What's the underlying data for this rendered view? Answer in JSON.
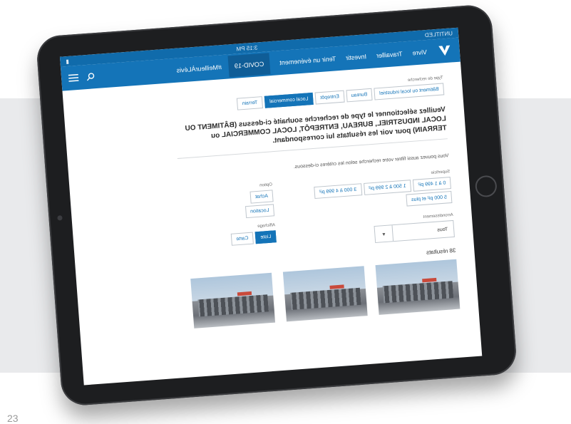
{
  "device": {
    "status_time": "3:15 PM",
    "status_carrier": "UNTITLED"
  },
  "nav": {
    "items": [
      "Vivre",
      "Travailler",
      "Investir",
      "Tenir un événement"
    ],
    "active_item": "COVID-19",
    "extra": "#MeilleurÀLévis"
  },
  "search": {
    "type_label": "Type de recherche",
    "types": [
      "Bâtiment ou local industriel",
      "Bureau",
      "Entrepôt",
      "Local commercial",
      "Terrain"
    ],
    "active_type": "Local commercial",
    "notice": "Veuillez sélectionner le type de recherche souhaité ci-dessus (BÂTIMENT OU LOCAL INDUSTRIEL, BUREAU, ENTREPÔT, LOCAL COMMERCIAL ou TERRAIN) pour voir les résultats lui correspondant.",
    "hint": "Vous pouvez aussi filtrer votre recherche selon les critères ci-dessous."
  },
  "filters": {
    "superficie_label": "Superficie",
    "superficie_options": [
      "0 à 1 499 pi²",
      "1 500 à 2 999 pi²",
      "3 000 à 4 999 pi²",
      "5 000 pi² et plus"
    ],
    "option_label": "Option",
    "option_items": [
      "Achat",
      "Location"
    ],
    "arrondissement_label": "Arrondissement",
    "arrondissement_value": "Tous",
    "affichage_label": "Affichage",
    "affichage_items": [
      "Liste",
      "Carte"
    ],
    "affichage_active": "Liste"
  },
  "results": {
    "count_text": "38 résultats"
  },
  "colors": {
    "primary": "#1474b8",
    "band": "#e9eaec"
  },
  "page_number": "23"
}
